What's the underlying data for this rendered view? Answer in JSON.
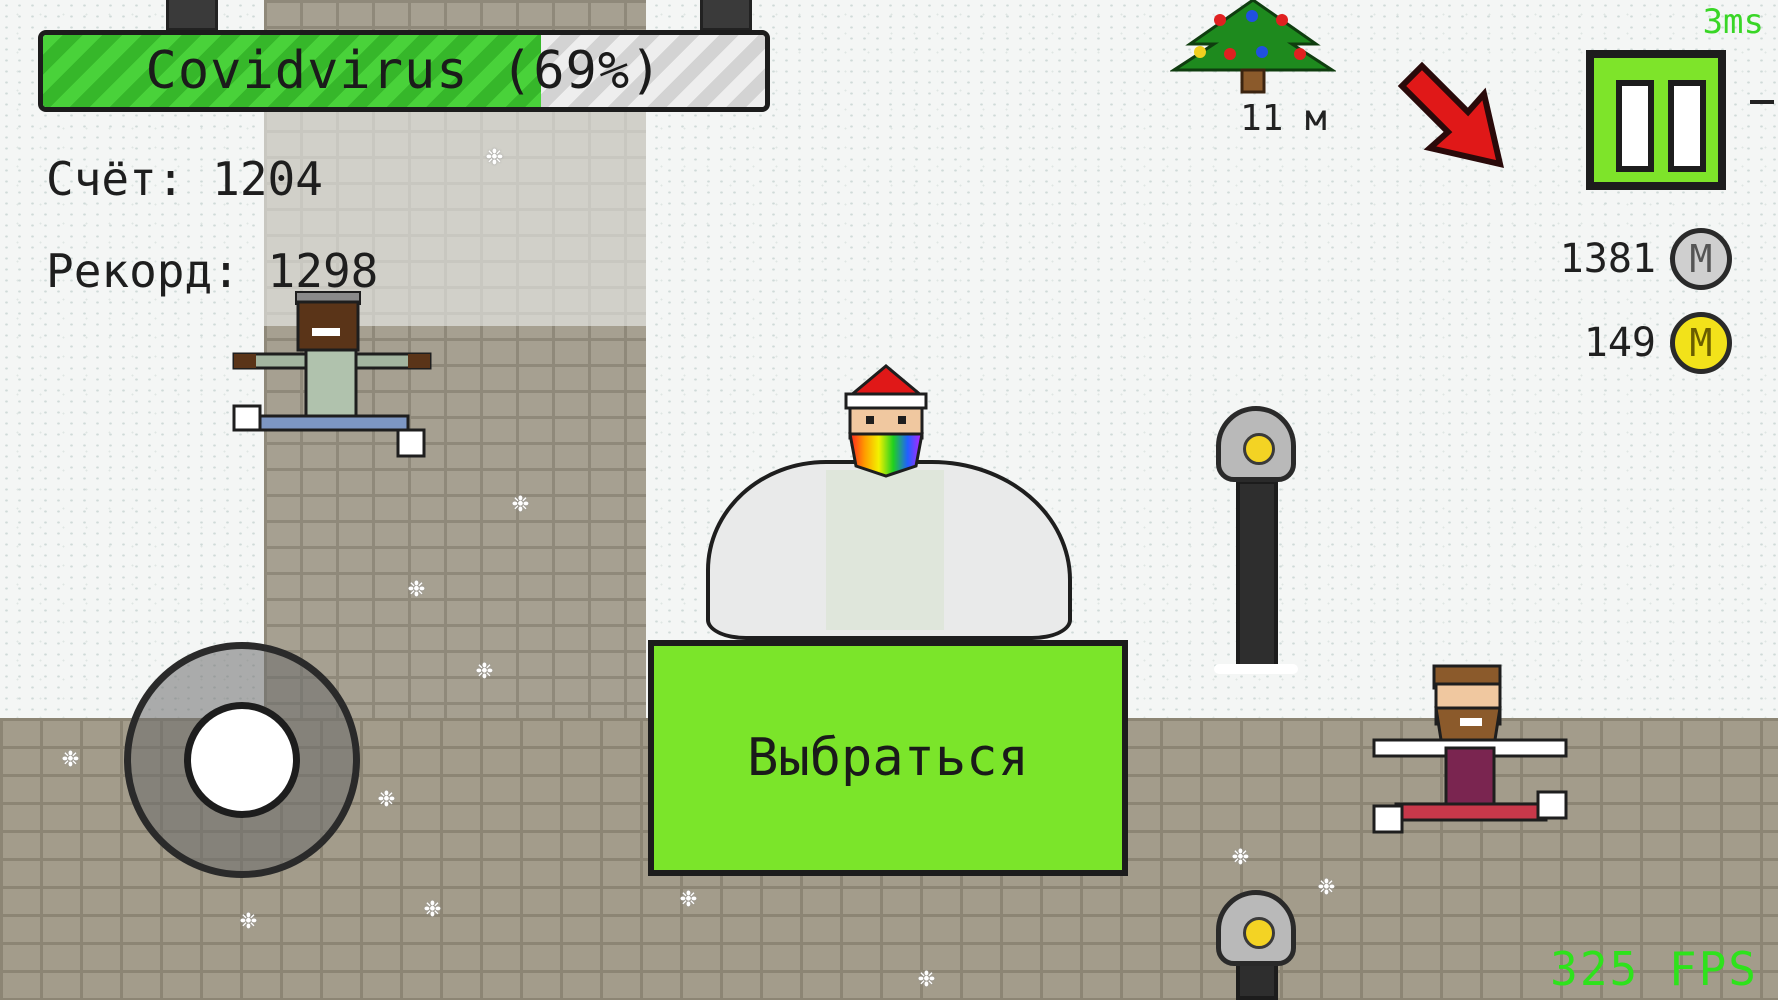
{
  "hud": {
    "virus_label": "Covidvirus (69%)",
    "virus_progress": 0.69,
    "score_label": "Счёт: 1204",
    "record_label": "Рекорд: 1298",
    "frame_ms": "3ms",
    "fps": "325 FPS"
  },
  "currency": {
    "silver_count": "1381",
    "silver_symbol": "M",
    "gold_count": "149",
    "gold_symbol": "M"
  },
  "objective": {
    "distance": "11 м",
    "icon": "christmas-tree-icon",
    "direction_icon": "red-arrow-icon"
  },
  "buttons": {
    "exit_label": "Выбраться",
    "pause_icon": "pause-icon"
  },
  "colors": {
    "accent_green": "#7be52a",
    "virus_green": "#49d23a",
    "fps_green": "#2ee21c",
    "coin_gold": "#f2e21a",
    "coin_silver": "#cfcfcf",
    "arrow_red": "#e01818"
  }
}
